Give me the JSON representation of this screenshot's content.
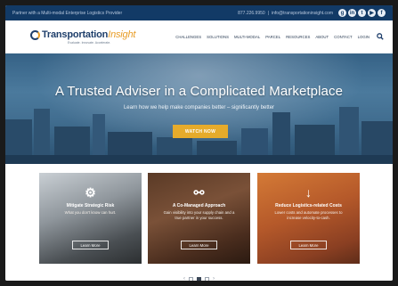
{
  "utility_bar": {
    "tagline": "Partner with a Multi-modal Enterprise Logistics Provider",
    "phone": "877.226.9950",
    "separator": "|",
    "email": "info@transportationinsight.com",
    "social_icons": [
      "google-plus-icon",
      "linkedin-icon",
      "twitter-icon",
      "youtube-icon",
      "facebook-icon"
    ]
  },
  "logo": {
    "name_main": "Transportation",
    "name_accent": "Insight",
    "tagline": "Evaluate. Innovate. Accelerate."
  },
  "nav": {
    "items": [
      "CHALLENGES",
      "SOLUTIONS",
      "MULTI-MODAL",
      "PARCEL",
      "RESOURCES",
      "ABOUT",
      "CONTACT",
      "LOGIN"
    ],
    "search_icon": "search-icon"
  },
  "hero": {
    "headline": "A Trusted Adviser in a Complicated Marketplace",
    "subheadline": "Learn how we help make companies better – significantly better",
    "cta": "WATCH NOW"
  },
  "cards": [
    {
      "icon": "gears-icon",
      "title": "Mitigate Strategic Risk",
      "desc": "What you don't know can hurt.",
      "cta": "Learn More"
    },
    {
      "icon": "link-icon",
      "title": "A Co-Managed Approach",
      "desc": "Gain visibility into your supply chain and a true partner in your success.",
      "cta": "Learn More"
    },
    {
      "icon": "arrow-down-icon",
      "title": "Reduce Logistics-related Costs",
      "desc": "Lower costs and automate processes to increase velocity-to-cash.",
      "cta": "Learn More"
    }
  ],
  "pager": {
    "prev": "‹",
    "next": "›",
    "active_index": 2,
    "count": 3
  },
  "colors": {
    "brand_navy": "#123a66",
    "brand_orange": "#e89d27",
    "cta_gold": "#e6ab2b"
  }
}
